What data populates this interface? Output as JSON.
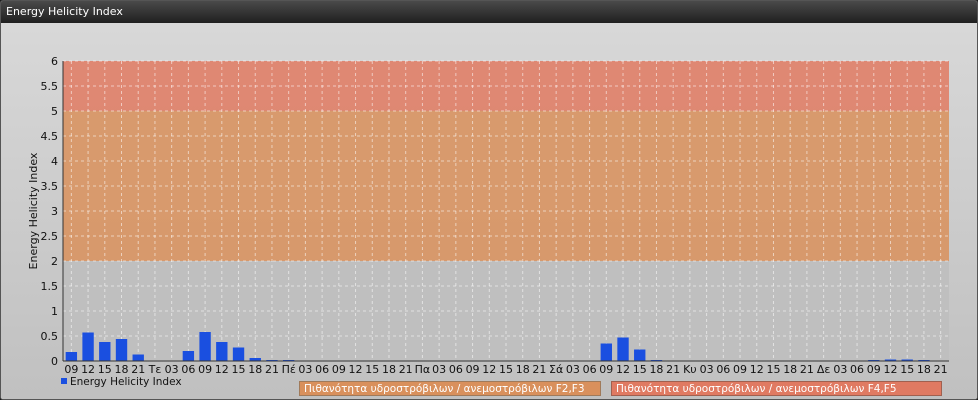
{
  "window": {
    "title": "Energy Helicity Index"
  },
  "chart_data": {
    "type": "bar",
    "ylabel": "Energy Helicity Index",
    "ylim": [
      0,
      6
    ],
    "yticks": [
      "0",
      "0.5",
      "1",
      "1.5",
      "2",
      "2.5",
      "3",
      "3.5",
      "4",
      "4.5",
      "5",
      "5.5",
      "6"
    ],
    "categories": [
      "09",
      "12",
      "15",
      "18",
      "21",
      "Τε",
      "03",
      "06",
      "09",
      "12",
      "15",
      "18",
      "21",
      "Πέ",
      "03",
      "06",
      "09",
      "12",
      "15",
      "18",
      "21",
      "Πα",
      "03",
      "06",
      "09",
      "12",
      "15",
      "18",
      "21",
      "Σά",
      "03",
      "06",
      "09",
      "12",
      "15",
      "18",
      "21",
      "Κυ",
      "03",
      "06",
      "09",
      "12",
      "15",
      "18",
      "21",
      "Δε",
      "03",
      "06",
      "09",
      "12",
      "15",
      "18",
      "21"
    ],
    "series": [
      {
        "name": "Energy Helicity Index",
        "color": "#1a4fe0",
        "values": [
          0.18,
          0.57,
          0.38,
          0.44,
          0.13,
          0.01,
          0.01,
          0.2,
          0.58,
          0.38,
          0.27,
          0.06,
          0.02,
          0.02,
          0.01,
          0.01,
          0.01,
          0.01,
          0.01,
          0.01,
          0.01,
          0.01,
          0.01,
          0.01,
          0.01,
          0.01,
          0.01,
          0.01,
          0.01,
          0.01,
          0.01,
          0.01,
          0.35,
          0.47,
          0.23,
          0.02,
          0.01,
          0.01,
          0.01,
          0.01,
          0.01,
          0.01,
          0.01,
          0.01,
          0.01,
          0.01,
          0.01,
          0.01,
          0.02,
          0.03,
          0.03,
          0.02,
          0.01
        ]
      }
    ],
    "bands": [
      {
        "from": 2,
        "to": 5,
        "label": "Πιθανότητα υδροστρόβιλων / ανεμοστρόβιλων F2,F3",
        "color": "#d9905c"
      },
      {
        "from": 5,
        "to": 6,
        "label": "Πιθανότητα υδροστρόβιλων / ανεμοστρόβιλων F4,F5",
        "color": "#e07a62"
      }
    ],
    "grid": true,
    "legend": "bottom-left"
  }
}
